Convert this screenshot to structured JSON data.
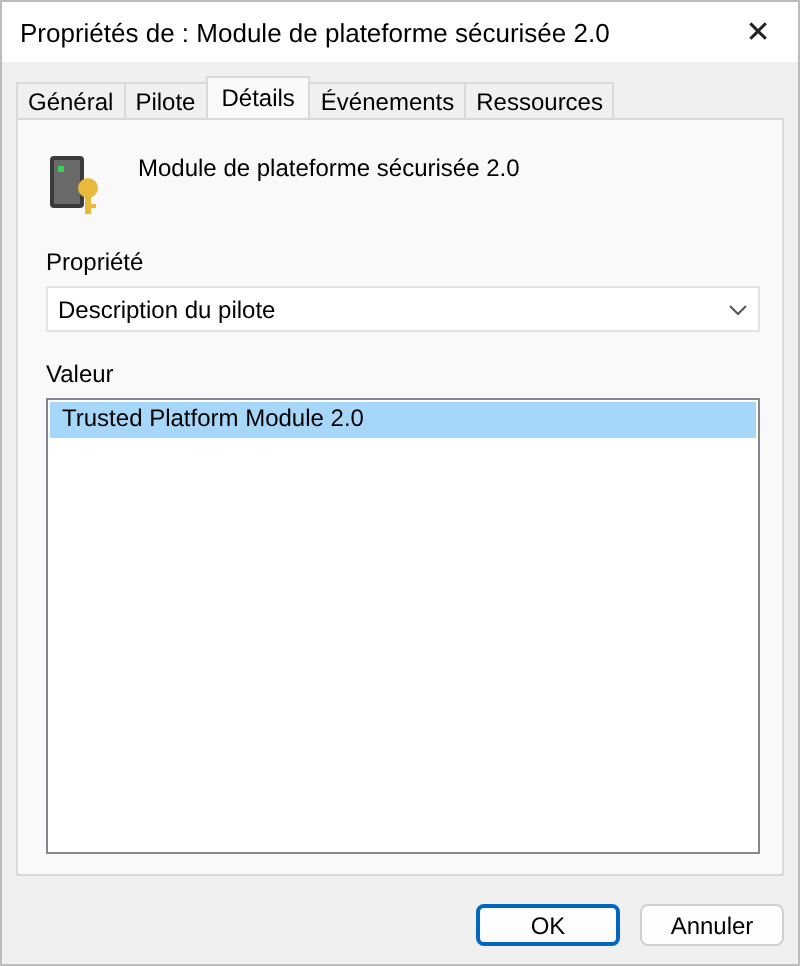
{
  "window": {
    "title": "Propriétés de : Module de plateforme sécurisée 2.0",
    "close": "✕"
  },
  "tabs": [
    {
      "label": "Général",
      "selected": false
    },
    {
      "label": "Pilote",
      "selected": false
    },
    {
      "label": "Détails",
      "selected": true
    },
    {
      "label": "Événements",
      "selected": false
    },
    {
      "label": "Ressources",
      "selected": false
    }
  ],
  "device": {
    "name": "Module de plateforme sécurisée 2.0"
  },
  "property": {
    "label": "Propriété",
    "value": "Description du pilote"
  },
  "values": {
    "label": "Valeur",
    "items": [
      {
        "text": "Trusted Platform Module 2.0",
        "selected": true
      }
    ]
  },
  "buttons": [
    {
      "label": "OK",
      "focused": true
    },
    {
      "label": "Annuler",
      "focused": false
    }
  ]
}
